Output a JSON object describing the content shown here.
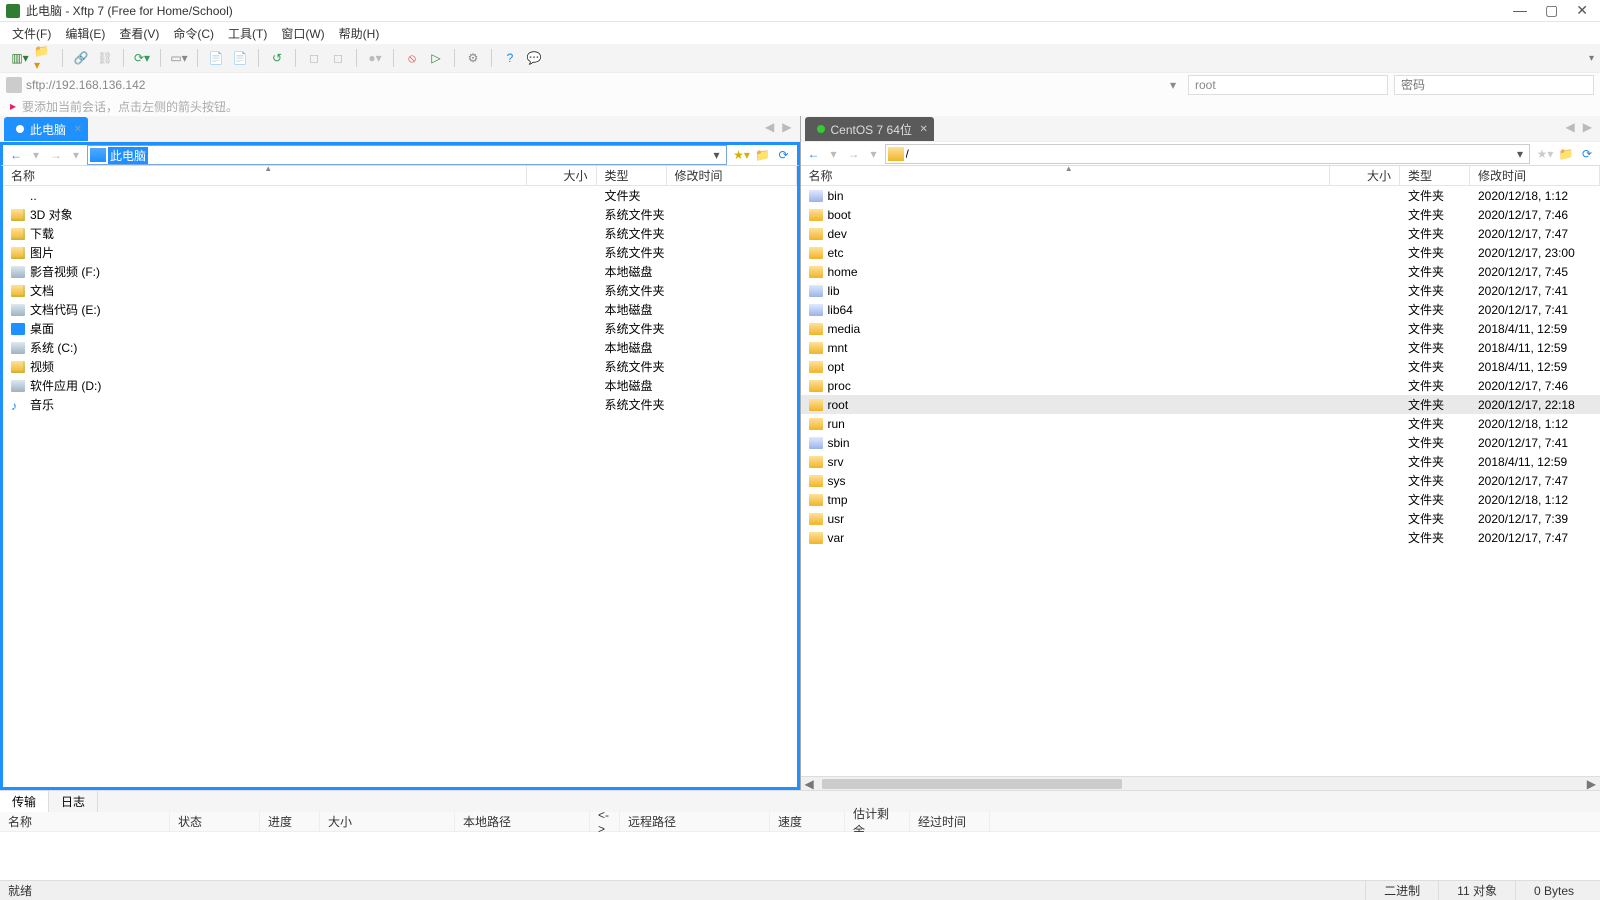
{
  "window": {
    "title": "此电脑 - Xftp 7 (Free for Home/School)"
  },
  "menus": [
    "文件(F)",
    "编辑(E)",
    "查看(V)",
    "命令(C)",
    "工具(T)",
    "窗口(W)",
    "帮助(H)"
  ],
  "addressbar": {
    "url": "sftp://192.168.136.142",
    "user": "root",
    "password_placeholder": "密码"
  },
  "hint": "要添加当前会话，点击左侧的箭头按钮。",
  "left": {
    "tab": "此电脑",
    "path_label": "此电脑",
    "columns": {
      "name": "名称",
      "size": "大小",
      "type": "类型",
      "date": "修改时间"
    },
    "rows": [
      {
        "name": "..",
        "type": "",
        "date": "",
        "icon": "fi-up"
      },
      {
        "name": "3D 对象",
        "type": "系统文件夹",
        "date": "",
        "icon": "fi-folder-sys"
      },
      {
        "name": "下载",
        "type": "系统文件夹",
        "date": "",
        "icon": "fi-folder-sys"
      },
      {
        "name": "图片",
        "type": "系统文件夹",
        "date": "",
        "icon": "fi-folder-sys"
      },
      {
        "name": "影音视频 (F:)",
        "type": "本地磁盘",
        "date": "",
        "icon": "fi-disk"
      },
      {
        "name": "文档",
        "type": "系统文件夹",
        "date": "",
        "icon": "fi-folder-sys"
      },
      {
        "name": "文档代码 (E:)",
        "type": "本地磁盘",
        "date": "",
        "icon": "fi-disk"
      },
      {
        "name": "桌面",
        "type": "系统文件夹",
        "date": "",
        "icon": "fi-desktop"
      },
      {
        "name": "系统 (C:)",
        "type": "本地磁盘",
        "date": "",
        "icon": "fi-disk"
      },
      {
        "name": "视频",
        "type": "系统文件夹",
        "date": "",
        "icon": "fi-folder-sys"
      },
      {
        "name": "软件应用 (D:)",
        "type": "本地磁盘",
        "date": "",
        "icon": "fi-disk"
      },
      {
        "name": "音乐",
        "type": "系统文件夹",
        "date": "",
        "icon": "fi-music"
      }
    ],
    "up_type": "文件夹"
  },
  "right": {
    "tab": "CentOS 7 64位",
    "path_label": "/",
    "columns": {
      "name": "名称",
      "size": "大小",
      "type": "类型",
      "date": "修改时间"
    },
    "rows": [
      {
        "name": "bin",
        "type": "文件夹",
        "date": "2020/12/18, 1:12",
        "icon": "fi-link"
      },
      {
        "name": "boot",
        "type": "文件夹",
        "date": "2020/12/17, 7:46",
        "icon": "fi-folder"
      },
      {
        "name": "dev",
        "type": "文件夹",
        "date": "2020/12/17, 7:47",
        "icon": "fi-folder"
      },
      {
        "name": "etc",
        "type": "文件夹",
        "date": "2020/12/17, 23:00",
        "icon": "fi-folder"
      },
      {
        "name": "home",
        "type": "文件夹",
        "date": "2020/12/17, 7:45",
        "icon": "fi-folder"
      },
      {
        "name": "lib",
        "type": "文件夹",
        "date": "2020/12/17, 7:41",
        "icon": "fi-link"
      },
      {
        "name": "lib64",
        "type": "文件夹",
        "date": "2020/12/17, 7:41",
        "icon": "fi-link"
      },
      {
        "name": "media",
        "type": "文件夹",
        "date": "2018/4/11, 12:59",
        "icon": "fi-folder"
      },
      {
        "name": "mnt",
        "type": "文件夹",
        "date": "2018/4/11, 12:59",
        "icon": "fi-folder"
      },
      {
        "name": "opt",
        "type": "文件夹",
        "date": "2018/4/11, 12:59",
        "icon": "fi-folder"
      },
      {
        "name": "proc",
        "type": "文件夹",
        "date": "2020/12/17, 7:46",
        "icon": "fi-folder"
      },
      {
        "name": "root",
        "type": "文件夹",
        "date": "2020/12/17, 22:18",
        "icon": "fi-folder",
        "selected": true
      },
      {
        "name": "run",
        "type": "文件夹",
        "date": "2020/12/18, 1:12",
        "icon": "fi-folder"
      },
      {
        "name": "sbin",
        "type": "文件夹",
        "date": "2020/12/17, 7:41",
        "icon": "fi-link"
      },
      {
        "name": "srv",
        "type": "文件夹",
        "date": "2018/4/11, 12:59",
        "icon": "fi-folder"
      },
      {
        "name": "sys",
        "type": "文件夹",
        "date": "2020/12/17, 7:47",
        "icon": "fi-folder"
      },
      {
        "name": "tmp",
        "type": "文件夹",
        "date": "2020/12/18, 1:12",
        "icon": "fi-folder"
      },
      {
        "name": "usr",
        "type": "文件夹",
        "date": "2020/12/17, 7:39",
        "icon": "fi-folder"
      },
      {
        "name": "var",
        "type": "文件夹",
        "date": "2020/12/17, 7:47",
        "icon": "fi-folder"
      }
    ]
  },
  "bottom_tabs": {
    "transfer": "传输",
    "log": "日志"
  },
  "transfer_cols": [
    "名称",
    "状态",
    "进度",
    "大小",
    "本地路径",
    "<->",
    "远程路径",
    "速度",
    "估计剩余...",
    "经过时间"
  ],
  "status": {
    "left": "就绪",
    "mode": "二进制",
    "objects": "11 对象",
    "bytes": "0 Bytes"
  }
}
